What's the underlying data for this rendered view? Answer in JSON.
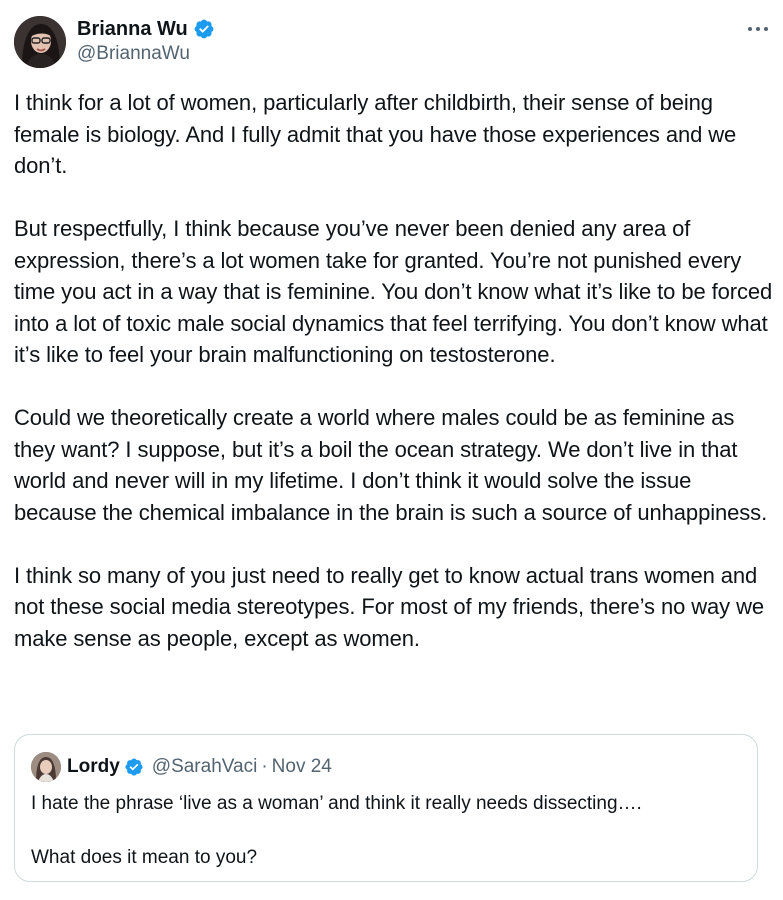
{
  "author": {
    "display_name": "Brianna Wu",
    "handle": "@BriannaWu",
    "verified_icon": "verified-badge-icon",
    "avatar_icon": "profile-photo"
  },
  "more_icon": "more-options-icon",
  "tweet": {
    "paragraphs": [
      "I think for a lot of women, particularly after childbirth, their sense of being female is biology. And I fully admit that you have those experiences and we don’t.",
      "But respectfully, I think because you’ve never been denied any area of expression, there’s a lot women take for granted. You’re not punished every time you act in a way that is feminine. You don’t know what it’s like to be forced into a lot of toxic male social dynamics that feel terrifying. You don’t know what it’s like to feel your brain malfunctioning on testosterone.",
      "Could we theoretically create a world where males could be as feminine as they want? I suppose, but it’s a boil the ocean strategy. We don’t live in that world and never will in my lifetime. I don’t think it would solve the issue because the chemical imbalance in the brain is such a source of unhappiness.",
      "I think so many of you just need to really get to know actual trans women and not these social media stereotypes. For most of my friends, there’s no way we make sense as people, except as women."
    ]
  },
  "quoted": {
    "display_name": "Lordy",
    "handle": "@SarahVaci",
    "separator": "·",
    "date": "Nov 24",
    "paragraphs": [
      "I hate the phrase ‘live as a woman’ and think it really needs dissecting….",
      "What does it mean to you?"
    ]
  },
  "colors": {
    "text": "#0f1419",
    "secondary": "#536471",
    "verified": "#1d9bf0",
    "border": "#cfd9de"
  }
}
